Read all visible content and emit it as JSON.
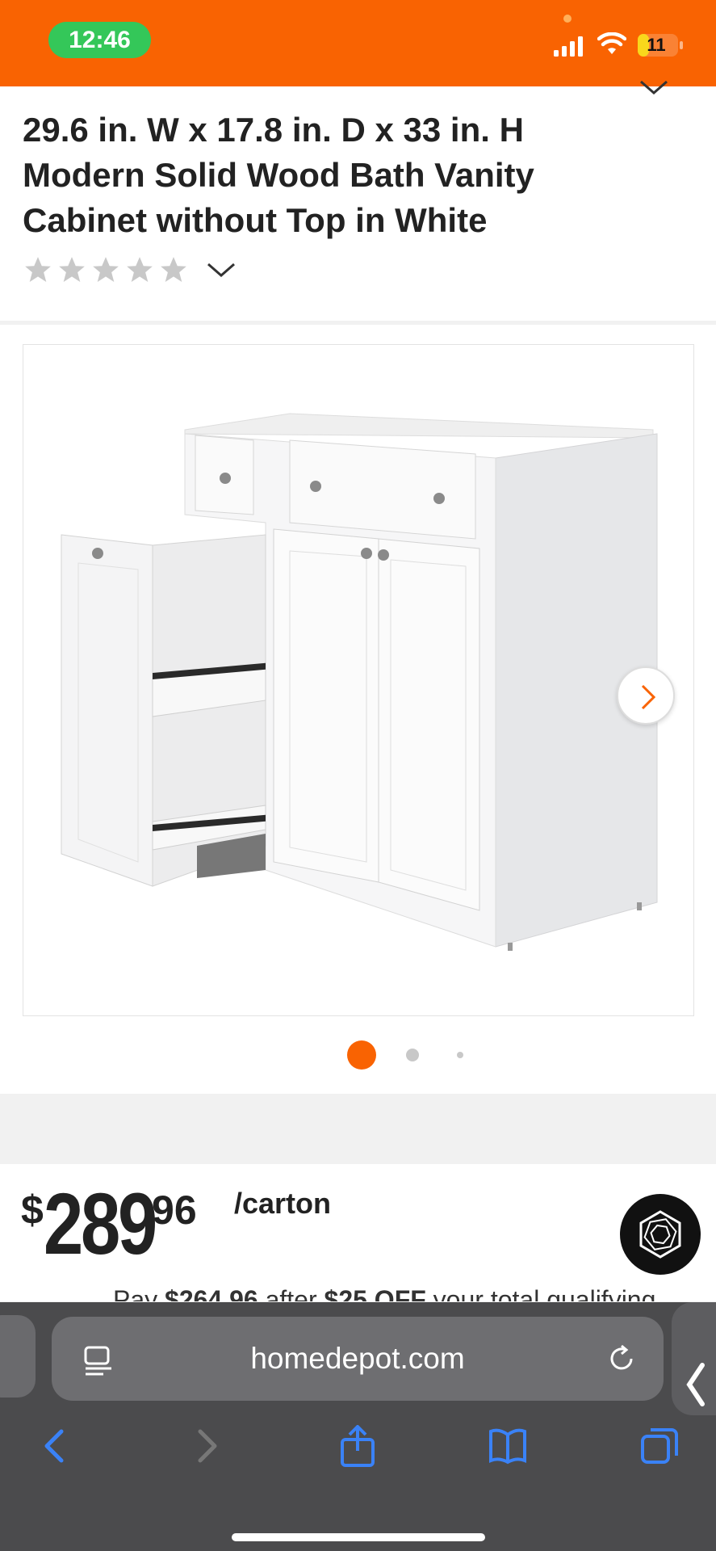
{
  "status_bar": {
    "time": "12:46",
    "battery_level": "11",
    "battery_fraction": 0.11
  },
  "product": {
    "title": "29.6 in. W x 17.8 in. D x 33 in. H Modern Solid Wood Bath Vanity Cabinet without Top in White",
    "rating_stars_filled": 0,
    "rating_stars_total": 5,
    "image_alt_icon": "vanity-cabinet-image"
  },
  "gallery": {
    "active_index": 0,
    "dot_count": 3
  },
  "price": {
    "symbol": "$",
    "dollars": "289",
    "cents": "96",
    "unit": "/carton",
    "promo_prefix": "Pay ",
    "promo_amount": "$264.96",
    "promo_mid": " after ",
    "promo_discount": "$25 OFF",
    "promo_suffix": " your total qualifying"
  },
  "browser": {
    "url": "homedepot.com"
  },
  "colors": {
    "brand_orange": "#f96302",
    "status_green": "#34c759",
    "safari_blue": "#3a82f7"
  }
}
